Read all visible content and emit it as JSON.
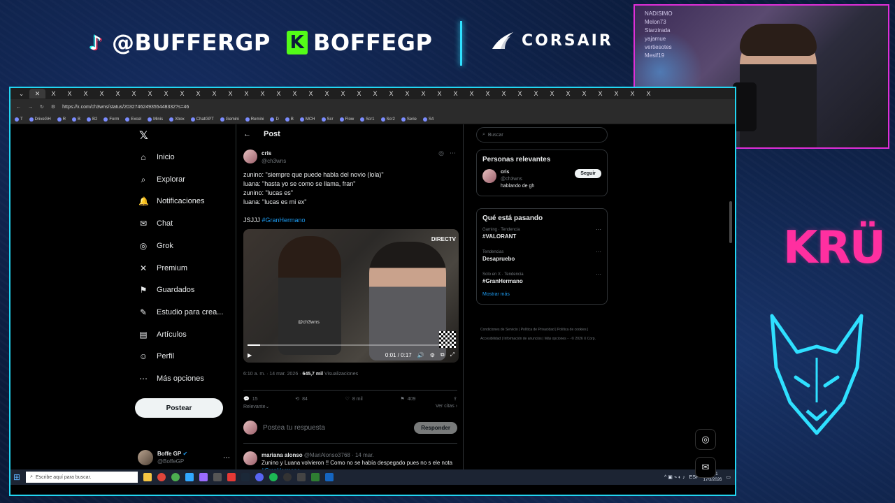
{
  "overlay": {
    "tiktok_handle": "@BUFFERGP",
    "kick_handle": "BOFFEGP",
    "sponsor": "CORSAIR",
    "team_logo": "KRÜ",
    "colors": {
      "accent_cyan": "#22d6f2",
      "accent_pink": "#e02ed8",
      "kick_green": "#53fc18",
      "kru_pink": "#ff2fa0"
    }
  },
  "webcam": {
    "chat_lines": [
      "NADISIMO",
      "Melon73",
      "Starzirada",
      "yajamue",
      "vertiesotes",
      "Mesif19"
    ]
  },
  "browser": {
    "tab_label": "X",
    "tab_count": 38,
    "url": "https://x.com/ch3wns/status/2032746249355448332?s=46",
    "bookmarks": [
      "T",
      "DriveGH",
      "R",
      "B",
      "B2",
      "Form",
      "Excel",
      "Minis",
      "Xbox",
      "ChatGPT",
      "Gemini",
      "Remini",
      "D",
      "B",
      "MCH",
      "Scr",
      "Flow",
      "Scr1",
      "Scr2",
      "Serie",
      "S4"
    ]
  },
  "nav": {
    "items": [
      {
        "label": "Inicio",
        "icon": "home-icon",
        "glyph": "⌂"
      },
      {
        "label": "Explorar",
        "icon": "search-icon",
        "glyph": "⌕"
      },
      {
        "label": "Notificaciones",
        "icon": "bell-icon",
        "glyph": "🔔"
      },
      {
        "label": "Chat",
        "icon": "chat-icon",
        "glyph": "✉"
      },
      {
        "label": "Grok",
        "icon": "grok-icon",
        "glyph": "◎"
      },
      {
        "label": "Premium",
        "icon": "premium-icon",
        "glyph": "✕"
      },
      {
        "label": "Guardados",
        "icon": "bookmark-icon",
        "glyph": "⚑"
      },
      {
        "label": "Estudio para crea...",
        "icon": "studio-icon",
        "glyph": "✎"
      },
      {
        "label": "Artículos",
        "icon": "articles-icon",
        "glyph": "▤"
      },
      {
        "label": "Perfil",
        "icon": "profile-icon",
        "glyph": "☺"
      },
      {
        "label": "Más opciones",
        "icon": "more-icon",
        "glyph": "⋯"
      }
    ],
    "post_button": "Postear",
    "user_name": "Boffe GP",
    "user_handle": "@BoffeGP"
  },
  "post": {
    "header": "Post",
    "author_name": "cris",
    "author_handle": "@ch3wns",
    "text": "zunino: \"siempre que puede habla del novio (lola)\"\nluana: \"hasta yo se como se llama, fran\"\nzunino: \"lucas es\"\nluana: \"lucas es mi ex\"\n\nJSJJJ ",
    "hashtag": "#GranHermano",
    "video": {
      "watermark": "@ch3wns",
      "brand": "DIRECTV",
      "time": "0:01 / 0:17",
      "progress": 0.06
    },
    "timestamp": "6:10 a. m. · 14 mar. 2026 · ",
    "views": "645,7 mil",
    "views_label": " Visualizaciones",
    "replies": "15",
    "reposts": "84",
    "likes": "8 mil",
    "bookmarks": "409",
    "sort": "Relevante",
    "quotes": "Ver citas",
    "reply_placeholder": "Postea tu respuesta",
    "reply_button": "Responder"
  },
  "reply": {
    "name": "mariana alonso",
    "handle": "@MariAlonso3768 · 14 mar.",
    "text": "Zunino y Luana volvieron !! Como no se había despegado pues no s ele nota",
    "hashtag": "#GranHermano"
  },
  "sidebar": {
    "search_placeholder": "Buscar",
    "relevant_title": "Personas relevantes",
    "relevant_user": {
      "name": "cris",
      "handle": "@ch3wns",
      "bio": "hablando de gh",
      "button": "Seguir"
    },
    "trends_title": "Qué está pasando",
    "trends": [
      {
        "context": "Gaming · Tendencia",
        "name": "#VALORANT"
      },
      {
        "context": "Tendencias",
        "name": "Desapruebo"
      },
      {
        "context": "Solo en X · Tendencia",
        "name": "#GranHermano"
      }
    ],
    "show_more": "Mostrar más",
    "footer": "Condiciones de Servicio | Política de Privacidad | Política de cookies | Accesibilidad | Información de anuncios | Más opciones ··· © 2026 X Corp."
  },
  "taskbar": {
    "search_placeholder": "Escribe aquí para buscar.",
    "lang": "ESP",
    "time": "01:51",
    "date": "17/3/2026"
  }
}
